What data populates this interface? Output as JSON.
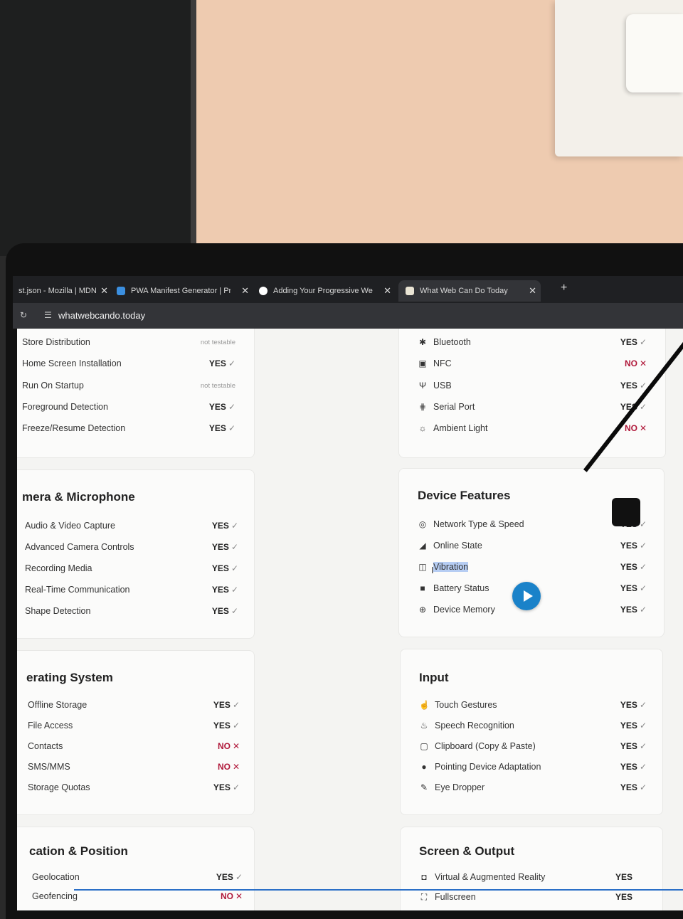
{
  "browser": {
    "tabs": [
      {
        "title": "st.json - Mozilla | MDN",
        "active": false
      },
      {
        "title": "PWA Manifest Generator | Pro",
        "active": false
      },
      {
        "title": "Adding Your Progressive Web",
        "active": false
      },
      {
        "title": "What Web Can Do Today",
        "active": true
      }
    ],
    "close_glyph": "✕",
    "new_tab_glyph": "+",
    "url": "whatwebcando.today"
  },
  "cards": {
    "app_lifecycle": {
      "title": "",
      "items": [
        {
          "label": "Store Distribution",
          "status": "not testable"
        },
        {
          "label": "Home Screen Installation",
          "status": "YES"
        },
        {
          "label": "Run On Startup",
          "status": "not testable"
        },
        {
          "label": "Foreground Detection",
          "status": "YES"
        },
        {
          "label": "Freeze/Resume Detection",
          "status": "YES"
        }
      ]
    },
    "surroundings": {
      "title": "",
      "items": [
        {
          "label": "Bluetooth",
          "status": "YES",
          "icon": "bluetooth-icon"
        },
        {
          "label": "NFC",
          "status": "NO",
          "icon": "nfc-icon"
        },
        {
          "label": "USB",
          "status": "YES",
          "icon": "usb-icon"
        },
        {
          "label": "Serial Port",
          "status": "YES",
          "icon": "serial-port-icon"
        },
        {
          "label": "Ambient Light",
          "status": "NO",
          "icon": "ambient-light-icon"
        }
      ]
    },
    "camera": {
      "title": "mera & Microphone",
      "items": [
        {
          "label": "Audio & Video Capture",
          "status": "YES"
        },
        {
          "label": "Advanced Camera Controls",
          "status": "YES"
        },
        {
          "label": "Recording Media",
          "status": "YES"
        },
        {
          "label": "Real-Time Communication",
          "status": "YES"
        },
        {
          "label": "Shape Detection",
          "status": "YES"
        }
      ]
    },
    "device_features": {
      "title": "Device Features",
      "items": [
        {
          "label": "Network Type & Speed",
          "status": "YES",
          "icon": "network-icon"
        },
        {
          "label": "Online State",
          "status": "YES",
          "icon": "signal-icon"
        },
        {
          "label": "Vibration",
          "status": "YES",
          "icon": "vibration-icon"
        },
        {
          "label": "Battery Status",
          "status": "YES",
          "icon": "battery-icon"
        },
        {
          "label": "Device Memory",
          "status": "YES",
          "icon": "memory-icon"
        }
      ]
    },
    "os": {
      "title": "erating System",
      "items": [
        {
          "label": "Offline Storage",
          "status": "YES"
        },
        {
          "label": "File Access",
          "status": "YES"
        },
        {
          "label": "Contacts",
          "status": "NO"
        },
        {
          "label": "SMS/MMS",
          "status": "NO"
        },
        {
          "label": "Storage Quotas",
          "status": "YES"
        }
      ]
    },
    "input": {
      "title": "Input",
      "items": [
        {
          "label": "Touch Gestures",
          "status": "YES",
          "icon": "touch-icon"
        },
        {
          "label": "Speech Recognition",
          "status": "YES",
          "icon": "microphone-icon"
        },
        {
          "label": "Clipboard (Copy & Paste)",
          "status": "YES",
          "icon": "clipboard-icon"
        },
        {
          "label": "Pointing Device Adaptation",
          "status": "YES",
          "icon": "mouse-icon"
        },
        {
          "label": "Eye Dropper",
          "status": "YES",
          "icon": "eyedropper-icon"
        }
      ]
    },
    "location": {
      "title": "cation & Position",
      "items": [
        {
          "label": "Geolocation",
          "status": "YES"
        },
        {
          "label": "Geofencing",
          "status": "NO"
        }
      ]
    },
    "screen": {
      "title": "Screen & Output",
      "items": [
        {
          "label": "Virtual & Augmented Reality",
          "status": "YES",
          "icon": "vr-icon"
        },
        {
          "label": "Fullscreen",
          "status": "YES",
          "icon": "fullscreen-icon"
        }
      ]
    }
  },
  "marks": {
    "yes": "✓",
    "no": "✕"
  }
}
